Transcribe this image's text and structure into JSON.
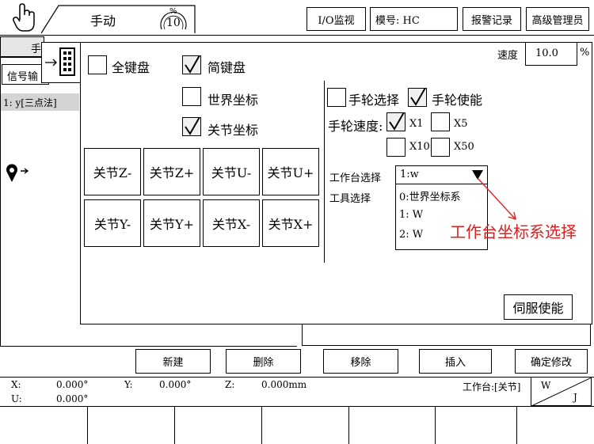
{
  "header": {
    "mode_label": "手动",
    "speed_symbol": "%",
    "speed_value": "10",
    "io_monitor": "I/O监视",
    "model": "模号: HC",
    "alarm_log": "报警记录",
    "admin": "高级管理员"
  },
  "background": {
    "tab_partial": "手",
    "signal_partial": "信号输",
    "program_line": "1: y[三点法]"
  },
  "panel": {
    "speed_label": "速度",
    "speed_value": "10.0",
    "speed_unit": "%",
    "full_keyboard": "全键盘",
    "full_keyboard_checked": false,
    "simple_keyboard": "简键盘",
    "simple_keyboard_checked": true,
    "world_coord": "世界坐标",
    "world_coord_checked": false,
    "joint_coord": "关节坐标",
    "joint_coord_checked": true,
    "jog_buttons": [
      "关节Z-",
      "关节Z+",
      "关节U-",
      "关节U+",
      "关节Y-",
      "关节Y+",
      "关节X-",
      "关节X+"
    ],
    "handwheel_select": "手轮选择",
    "handwheel_select_checked": false,
    "handwheel_enable": "手轮使能",
    "handwheel_enable_checked": true,
    "handwheel_speed": "手轮速度:",
    "speeds": [
      {
        "label": "X1",
        "checked": true
      },
      {
        "label": "X5",
        "checked": false
      },
      {
        "label": "X10",
        "checked": false
      },
      {
        "label": "X50",
        "checked": false
      }
    ],
    "workbench_select": "工作台选择",
    "workbench_value": "1:w",
    "tool_select": "工具选择",
    "dropdown_options": [
      "0:世界坐标系",
      "1: W",
      "2: W"
    ],
    "annotation": "工作台坐标系选择",
    "servo_enable": "伺服使能"
  },
  "actions": {
    "new": "新建",
    "delete": "删除",
    "remove": "移除",
    "insert": "插入",
    "confirm": "确定修改"
  },
  "status": {
    "x_label": "X:",
    "x_value": "0.000°",
    "y_label": "Y:",
    "y_value": "0.000°",
    "z_label": "Z:",
    "z_value": "0.000mm",
    "u_label": "U:",
    "u_value": "0.000°",
    "workbench_label": "工作台:[关节]",
    "coord_top": "W",
    "coord_bottom": "J"
  },
  "colors": {
    "annotation": "#e02020",
    "checked_bg": "#f0f0f0",
    "highlight_row": "#d4d4d4"
  }
}
